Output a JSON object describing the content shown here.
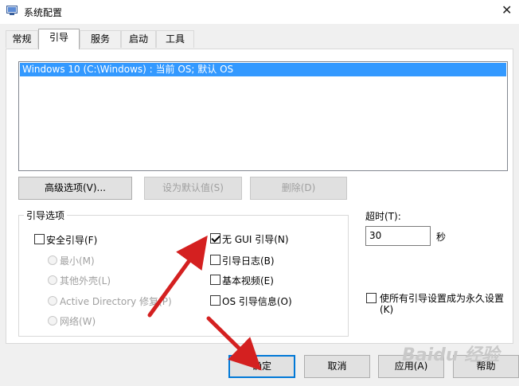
{
  "window": {
    "title": "系统配置",
    "close_glyph": "✕"
  },
  "tabs": [
    {
      "label": "常规",
      "active": false
    },
    {
      "label": "引导",
      "active": true
    },
    {
      "label": "服务",
      "active": false
    },
    {
      "label": "启动",
      "active": false
    },
    {
      "label": "工具",
      "active": false
    }
  ],
  "os_list": {
    "items": [
      "Windows 10 (C:\\Windows) : 当前 OS; 默认 OS"
    ],
    "selected_index": 0
  },
  "list_buttons": {
    "advanced": "高级选项(V)...",
    "set_default": "设为默认值(S)",
    "delete": "删除(D)"
  },
  "boot_options": {
    "group_label": "引导选项",
    "safe_boot": {
      "label": "安全引导(F)",
      "checked": false
    },
    "radios": [
      "最小(M)",
      "其他外壳(L)",
      "Active Directory 修复(P)",
      "网络(W)"
    ],
    "no_gui": {
      "label": "无 GUI 引导(N)",
      "checked": true
    },
    "boot_log": {
      "label": "引导日志(B)",
      "checked": false
    },
    "base_video": {
      "label": "基本视频(E)",
      "checked": false
    },
    "os_info": {
      "label": "OS 引导信息(O)",
      "checked": false
    }
  },
  "timeout": {
    "label": "超时(T):",
    "value": "30",
    "unit": "秒"
  },
  "permanent": {
    "label_line1": "使所有引导设置成为永久设置",
    "label_line2": "(K)",
    "checked": false
  },
  "footer_buttons": {
    "ok": "确定",
    "cancel": "取消",
    "apply": "应用(A)",
    "help": "帮助"
  },
  "watermark": "Baidu 经验",
  "colors": {
    "selection": "#3399ff",
    "arrow": "#d42020",
    "focus_border": "#0078d7"
  }
}
